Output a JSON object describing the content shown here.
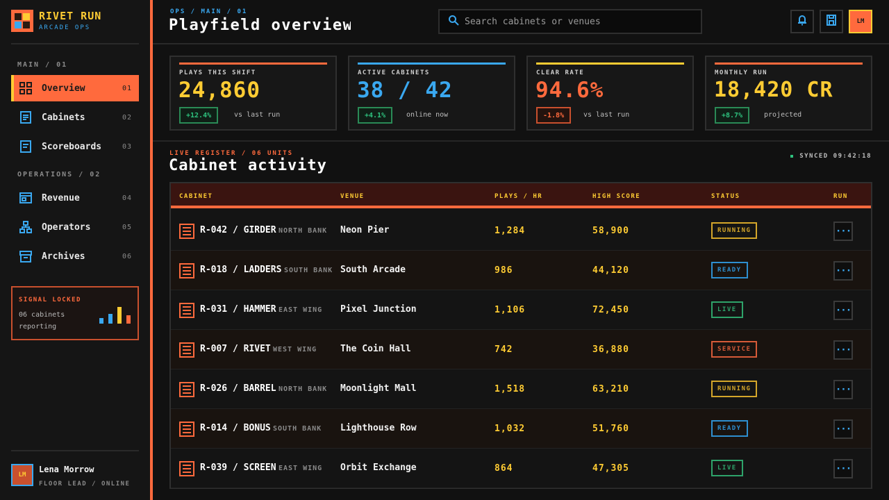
{
  "brand": {
    "title": "RIVET RUN",
    "subtitle": "ARCADE OPS"
  },
  "sidebar": {
    "sections": [
      {
        "label": "MAIN / 01"
      },
      {
        "label": "OPERATIONS / 02"
      }
    ],
    "items": [
      {
        "label": "Overview",
        "num": "01",
        "icon": "grid-icon"
      },
      {
        "label": "Cabinets",
        "num": "02",
        "icon": "document-icon"
      },
      {
        "label": "Scoreboards",
        "num": "03",
        "icon": "list-icon"
      },
      {
        "label": "Revenue",
        "num": "04",
        "icon": "window-icon"
      },
      {
        "label": "Operators",
        "num": "05",
        "icon": "org-chart-icon"
      },
      {
        "label": "Archives",
        "num": "06",
        "icon": "archive-icon"
      }
    ],
    "signal": {
      "title": "SIGNAL LOCKED",
      "text": "06 cabinets reporting"
    },
    "user": {
      "initials": "LM",
      "name": "Lena Morrow",
      "role": "FLOOR LEAD / ONLINE"
    }
  },
  "header": {
    "breadcrumb": "OPS / MAIN / 01",
    "title": "Playfield overview",
    "search_placeholder": "Search cabinets or venues",
    "avatar_initials": "LM"
  },
  "kpis": [
    {
      "label": "PLAYS THIS SHIFT",
      "value": "24,860",
      "delta": "+12.4%",
      "note": "vs last run",
      "accent": "#ff6a3d",
      "value_color": "#ffcc33",
      "delta_color": "#2ec27e"
    },
    {
      "label": "ACTIVE CABINETS",
      "value": "38 / 42",
      "delta": "+4.1%",
      "note": "online now",
      "accent": "#3aa8f0",
      "value_color": "#3aa8f0",
      "delta_color": "#2ec27e"
    },
    {
      "label": "CLEAR RATE",
      "value": "94.6%",
      "delta": "-1.8%",
      "note": "vs last run",
      "accent": "#ffcc33",
      "value_color": "#ff6a3d",
      "delta_color": "#ff6a3d"
    },
    {
      "label": "MONTHLY RUN",
      "value": "18,420 CR",
      "delta": "+8.7%",
      "note": "projected",
      "accent": "#ff6a3d",
      "value_color": "#ffcc33",
      "delta_color": "#2ec27e"
    }
  ],
  "activity": {
    "eyebrow": "LIVE REGISTER / 06 UNITS",
    "title": "Cabinet activity",
    "synced": "SYNCED 09:42:18",
    "columns": [
      "CABINET",
      "VENUE",
      "PLAYS / HR",
      "HIGH SCORE",
      "STATUS",
      "RUN"
    ],
    "rows": [
      {
        "cabinet": "R-042 / GIRDER",
        "zone": "NORTH BANK",
        "venue": "Neon Pier",
        "plays": "1,284",
        "score": "58,900",
        "status": "RUNNING",
        "status_color": "#d4a62a"
      },
      {
        "cabinet": "R-018 / LADDERS",
        "zone": "SOUTH BANK",
        "venue": "South Arcade",
        "plays": "986",
        "score": "44,120",
        "status": "READY",
        "status_color": "#2e8fd0"
      },
      {
        "cabinet": "R-031 / HAMMER",
        "zone": "EAST WING",
        "venue": "Pixel Junction",
        "plays": "1,106",
        "score": "72,450",
        "status": "LIVE",
        "status_color": "#2ea36a"
      },
      {
        "cabinet": "R-007 / RIVET",
        "zone": "WEST WING",
        "venue": "The Coin Hall",
        "plays": "742",
        "score": "36,880",
        "status": "SERVICE",
        "status_color": "#d65a38"
      },
      {
        "cabinet": "R-026 / BARREL",
        "zone": "NORTH BANK",
        "venue": "Moonlight Mall",
        "plays": "1,518",
        "score": "63,210",
        "status": "RUNNING",
        "status_color": "#d4a62a"
      },
      {
        "cabinet": "R-014 / BONUS",
        "zone": "SOUTH BANK",
        "venue": "Lighthouse Row",
        "plays": "1,032",
        "score": "51,760",
        "status": "READY",
        "status_color": "#2e8fd0"
      },
      {
        "cabinet": "R-039 / SCREEN",
        "zone": "EAST WING",
        "venue": "Orbit Exchange",
        "plays": "864",
        "score": "47,305",
        "status": "LIVE",
        "status_color": "#2ea36a"
      }
    ],
    "run_label": "···"
  }
}
